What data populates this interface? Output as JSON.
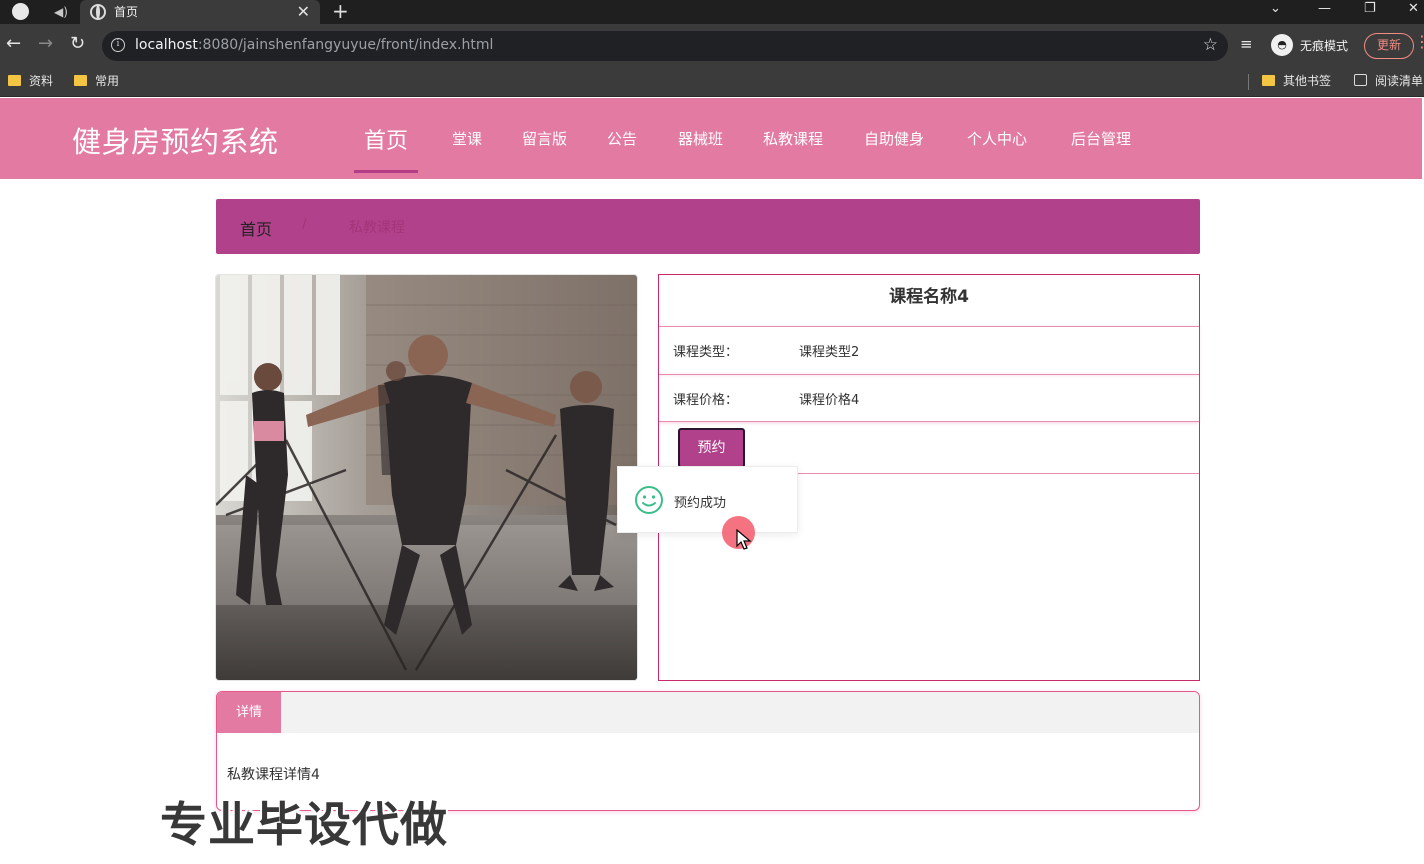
{
  "browser": {
    "tab_title": "首页",
    "address": {
      "host": "localhost",
      "path": ":8080/jainshenfangyuyue/front/index.html"
    },
    "incognito_label": "无痕模式",
    "update_label": "更新",
    "bookmarks": [
      "资料",
      "常用"
    ],
    "other_bookmarks_label": "其他书签",
    "reading_list_label": "阅读清单"
  },
  "site": {
    "logo": "健身房预约系统",
    "nav": [
      "首页",
      "堂课",
      "留言版",
      "公告",
      "器械班",
      "私教课程",
      "自助健身",
      "个人中心",
      "后台管理"
    ],
    "active_nav": "首页",
    "colors": {
      "header": "#e37aa1",
      "accent": "#b2418b"
    }
  },
  "breadcrumb": {
    "home": "首页",
    "separator": "/",
    "current": "私教课程"
  },
  "course": {
    "name": "课程名称4",
    "type_label": "课程类型：",
    "type_value": "课程类型2",
    "price_label": "课程价格：",
    "price_value": "课程价格4",
    "book_button": "预约"
  },
  "toast": {
    "icon": "smile-icon",
    "message": "预约成功"
  },
  "details": {
    "tab_label": "详情",
    "content": "私教课程详情4"
  },
  "watermark": "专业毕设代做"
}
